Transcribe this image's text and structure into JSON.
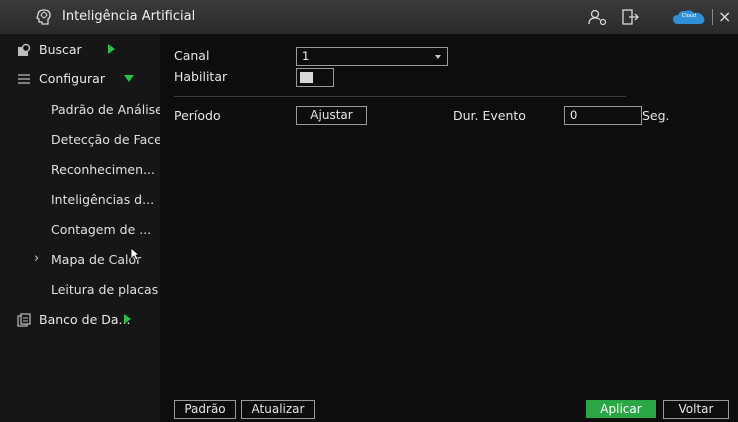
{
  "window": {
    "title": "Inteligência Artificial",
    "icons": [
      "ai-brain-icon",
      "user-settings-icon",
      "logout-icon",
      "cloud-icon",
      "close-icon"
    ],
    "cloud_badge_text": "Cloud",
    "close_glyph": "×"
  },
  "sidebar": {
    "items": [
      {
        "label": "Buscar",
        "icon": "search-icon",
        "expand": "right"
      },
      {
        "label": "Configurar",
        "icon": "list-icon",
        "expand": "down"
      },
      {
        "label": "Padrão de Análise",
        "sub": true
      },
      {
        "label": "Detecção de Face",
        "sub": true
      },
      {
        "label": "Reconhecimen...",
        "sub": true
      },
      {
        "label": "Inteligências d...",
        "sub": true
      },
      {
        "label": "Contagem de ...",
        "sub": true
      },
      {
        "label": "Mapa de Calor",
        "sub": true,
        "selected": true
      },
      {
        "label": "Leitura de placas",
        "sub": true
      },
      {
        "label": "Banco de Da...",
        "icon": "database-icon",
        "expand": "right"
      }
    ],
    "selected_chevron": "›"
  },
  "form": {
    "channel_label": "Canal",
    "channel_value": "1",
    "enable_label": "Habilitar",
    "enable_state": false,
    "period_label": "Período",
    "adjust_button": "Ajustar",
    "event_duration_label": "Dur. Evento",
    "event_duration_value": "0",
    "seconds_unit": "Seg."
  },
  "footer": {
    "default_button": "Padrão",
    "refresh_button": "Atualizar",
    "apply_button": "Aplicar",
    "back_button": "Voltar"
  },
  "colors": {
    "accent_green": "#29a744",
    "cloud_blue": "#2f8fd8",
    "background": "#0d0d0d",
    "sidebar_bg": "#161616",
    "titlebar_bg": "#2f2f2f"
  }
}
